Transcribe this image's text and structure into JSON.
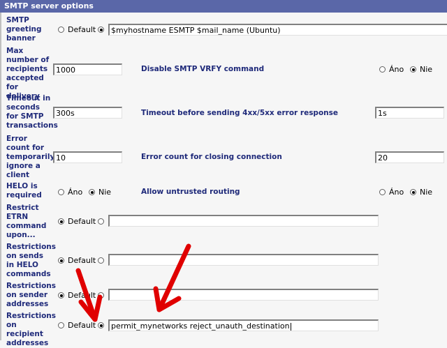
{
  "section": {
    "title": "SMTP server options"
  },
  "options": {
    "default": "Default",
    "yes": "Áno",
    "no": "Nie"
  },
  "fields": {
    "greeting_banner": {
      "label": "SMTP greeting banner",
      "value": "$myhostname ESMTP $mail_name (Ubuntu)"
    },
    "max_recipients": {
      "label": "Max number of recipients accepted for delivery",
      "value": "1000"
    },
    "disable_vrfy": {
      "label": "Disable SMTP VRFY command"
    },
    "timeout_transactions": {
      "label": "Timeout in seconds for SMTP transactions",
      "value": "300s"
    },
    "timeout_error": {
      "label": "Timeout before sending 4xx/5xx error response",
      "value": "1s"
    },
    "error_count_ignore": {
      "label": "Error count for temporarily ignore a client",
      "value": "10"
    },
    "error_count_close": {
      "label": "Error count for closing connection",
      "value": "20"
    },
    "helo_required": {
      "label": "HELO is required"
    },
    "allow_untrusted": {
      "label": "Allow untrusted routing"
    },
    "restrict_etrn": {
      "label": "Restrict ETRN command upon...",
      "value": ""
    },
    "restrict_helo": {
      "label": "Restrictions on sends in HELO commands",
      "value": ""
    },
    "restrict_sender": {
      "label": "Restrictions on sender addresses",
      "value": ""
    },
    "restrict_recipient": {
      "label": "Restrictions on recipient addresses",
      "value": "permit_mynetworks reject_unauth_destination"
    }
  },
  "colors": {
    "header_bg": "#5a67a8",
    "label_text": "#1f2a7a",
    "annotation_arrow": "#e00000"
  }
}
